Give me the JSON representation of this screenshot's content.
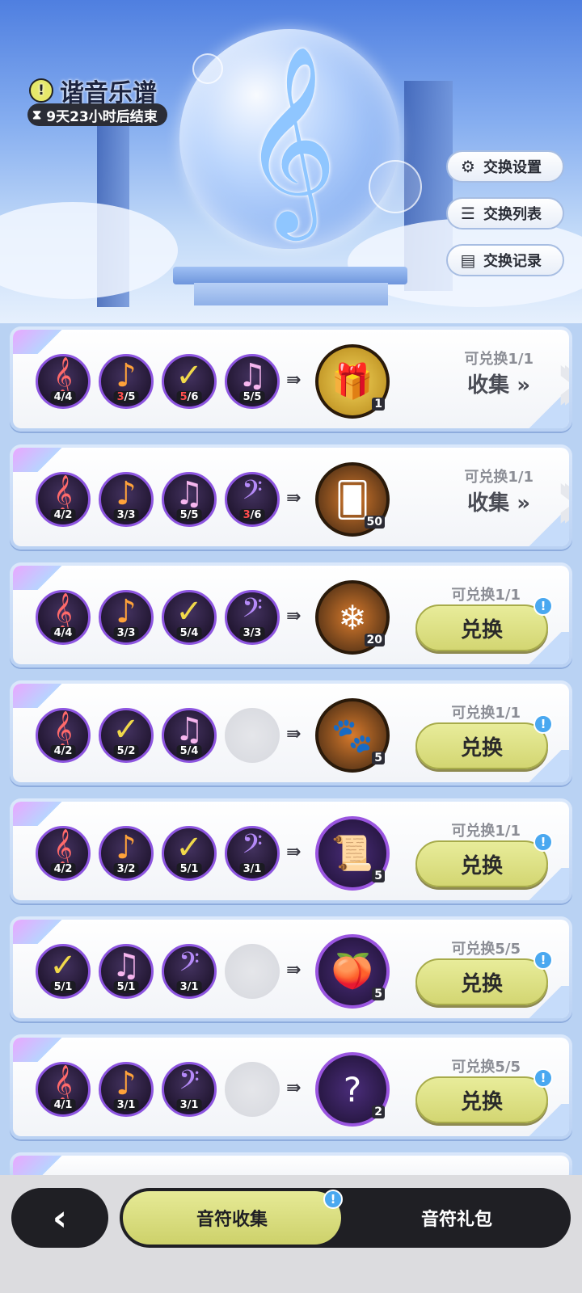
{
  "header": {
    "title": "谐音乐谱",
    "timer": "9天23小时后结束"
  },
  "side_buttons": [
    {
      "label": "交换设置",
      "icon": "gear-icon"
    },
    {
      "label": "交换列表",
      "icon": "list-icon"
    },
    {
      "label": "交换记录",
      "icon": "document-icon"
    }
  ],
  "rows": [
    {
      "notes": [
        {
          "type": "treble-clef",
          "have": "4",
          "need": "4",
          "short": false
        },
        {
          "type": "eighth-note",
          "have": "3",
          "need": "5",
          "short": true
        },
        {
          "type": "quarter-note",
          "have": "5",
          "need": "6",
          "short": true
        },
        {
          "type": "beamed-notes",
          "have": "5",
          "need": "5",
          "short": false
        }
      ],
      "reward": {
        "icon": "treasure-chest-icon",
        "quantity": "1",
        "color": "#e8b62c"
      },
      "limit": "可兑换1/1",
      "action": "收集",
      "action_kind": "collect"
    },
    {
      "notes": [
        {
          "type": "treble-clef",
          "have": "4",
          "need": "2",
          "short": false
        },
        {
          "type": "eighth-note",
          "have": "3",
          "need": "3",
          "short": false
        },
        {
          "type": "beamed-notes",
          "have": "5",
          "need": "5",
          "short": false
        },
        {
          "type": "bass-clef",
          "have": "3",
          "need": "6",
          "short": true
        }
      ],
      "reward": {
        "icon": "character-card-icon",
        "quantity": "50",
        "color": "#d77a2c"
      },
      "limit": "可兑换1/1",
      "action": "收集",
      "action_kind": "collect"
    },
    {
      "notes": [
        {
          "type": "treble-clef",
          "have": "4",
          "need": "4",
          "short": false
        },
        {
          "type": "eighth-note",
          "have": "3",
          "need": "3",
          "short": false
        },
        {
          "type": "quarter-note",
          "have": "5",
          "need": "4",
          "short": false
        },
        {
          "type": "bass-clef",
          "have": "3",
          "need": "3",
          "short": false
        }
      ],
      "reward": {
        "icon": "crystal-icon",
        "quantity": "20",
        "color": "#d77a2c"
      },
      "limit": "可兑换1/1",
      "action": "兑换",
      "action_kind": "redeem"
    },
    {
      "notes": [
        {
          "type": "treble-clef",
          "have": "4",
          "need": "2",
          "short": false
        },
        {
          "type": "quarter-note",
          "have": "5",
          "need": "2",
          "short": false
        },
        {
          "type": "beamed-notes",
          "have": "5",
          "need": "4",
          "short": false
        }
      ],
      "reward": {
        "icon": "paw-charm-icon",
        "quantity": "5",
        "color": "#d77a2c"
      },
      "limit": "可兑换1/1",
      "action": "兑换",
      "action_kind": "redeem"
    },
    {
      "notes": [
        {
          "type": "treble-clef",
          "have": "4",
          "need": "2",
          "short": false
        },
        {
          "type": "eighth-note",
          "have": "3",
          "need": "2",
          "short": false
        },
        {
          "type": "quarter-note",
          "have": "5",
          "need": "1",
          "short": false
        },
        {
          "type": "bass-clef",
          "have": "3",
          "need": "1",
          "short": false
        }
      ],
      "reward": {
        "icon": "scroll-icon",
        "quantity": "5",
        "color": "#9a55e0"
      },
      "limit": "可兑换1/1",
      "action": "兑换",
      "action_kind": "redeem"
    },
    {
      "notes": [
        {
          "type": "quarter-note",
          "have": "5",
          "need": "1",
          "short": false
        },
        {
          "type": "beamed-notes",
          "have": "5",
          "need": "1",
          "short": false
        },
        {
          "type": "bass-clef",
          "have": "3",
          "need": "1",
          "short": false
        }
      ],
      "reward": {
        "icon": "peach-icon",
        "quantity": "5",
        "color": "#9a55e0"
      },
      "limit": "可兑换5/5",
      "action": "兑换",
      "action_kind": "redeem"
    },
    {
      "notes": [
        {
          "type": "treble-clef",
          "have": "4",
          "need": "1",
          "short": false
        },
        {
          "type": "eighth-note",
          "have": "3",
          "need": "1",
          "short": false
        },
        {
          "type": "bass-clef",
          "have": "3",
          "need": "1",
          "short": false
        }
      ],
      "reward": {
        "icon": "mystery-box-icon",
        "quantity": "2",
        "color": "#9a55e0"
      },
      "limit": "可兑换5/5",
      "action": "兑换",
      "action_kind": "redeem"
    }
  ],
  "bottom": {
    "tabs": [
      {
        "label": "音符收集",
        "active": true
      },
      {
        "label": "音符礼包",
        "active": false
      }
    ]
  },
  "colors": {
    "accent": "#d3d672",
    "note_border": "#8d55e0",
    "shortfall": "#ff4d4d",
    "badge": "#4aa8f0"
  }
}
